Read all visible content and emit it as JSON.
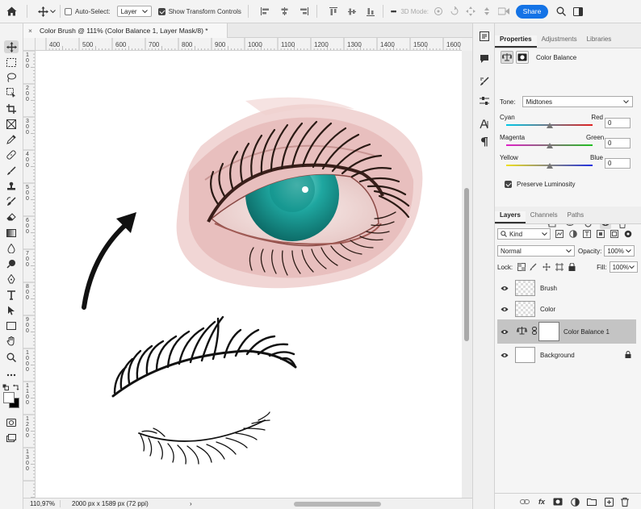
{
  "options_bar": {
    "auto_select_label": "Auto-Select:",
    "auto_select_target": "Layer",
    "show_transform_label": "Show Transform Controls",
    "three_d_mode_label": "3D Mode:",
    "share_label": "Share",
    "more_label": "•••"
  },
  "document": {
    "tab_title": "Color Brush @ 111% (Color Balance 1, Layer Mask/8) *",
    "close_glyph": "×"
  },
  "rulers": {
    "horizontal": [
      "400",
      "500",
      "600",
      "700",
      "800",
      "900",
      "1000",
      "1100",
      "1200",
      "1300",
      "1400",
      "1500",
      "1600"
    ],
    "vertical": [
      "100",
      "200",
      "300",
      "400",
      "500",
      "600",
      "700",
      "800",
      "900",
      "1000",
      "1100",
      "1200",
      "1300"
    ]
  },
  "status_bar": {
    "zoom": "110,97%",
    "dimensions": "2000 px x 1589 px (72 ppi)",
    "arrow": "›"
  },
  "properties_panel": {
    "tabs": [
      {
        "label": "Properties",
        "active": true
      },
      {
        "label": "Adjustments",
        "active": false
      },
      {
        "label": "Libraries",
        "active": false
      }
    ],
    "adjustment_name": "Color Balance",
    "tone_label": "Tone:",
    "tone_value": "Midtones",
    "sliders": [
      {
        "left": "Cyan",
        "right": "Red",
        "value": "0",
        "level": 0
      },
      {
        "left": "Magenta",
        "right": "Green",
        "value": "0",
        "level": 0
      },
      {
        "left": "Yellow",
        "right": "Blue",
        "value": "0",
        "level": 0
      }
    ],
    "preserve_label": "Preserve Luminosity",
    "preserve_checked": true
  },
  "layers_panel": {
    "tabs": [
      {
        "label": "Layers",
        "active": true
      },
      {
        "label": "Channels",
        "active": false
      },
      {
        "label": "Paths",
        "active": false
      }
    ],
    "filter_kind": "Kind",
    "blend_mode": "Normal",
    "opacity_label": "Opacity:",
    "opacity_value": "100%",
    "lock_label": "Lock:",
    "fill_label": "Fill:",
    "fill_value": "100%",
    "layers": [
      {
        "name": "Brush",
        "selected": false
      },
      {
        "name": "Color",
        "selected": false
      },
      {
        "name": "Color Balance 1",
        "selected": true
      },
      {
        "name": "Background",
        "selected": false,
        "locked": true
      }
    ],
    "fx_label": "fx"
  },
  "colors": {
    "accent": "#1473e6",
    "iris": "#1fa7a0",
    "skin": "#e6b5b3",
    "lash": "#2a1a14"
  }
}
